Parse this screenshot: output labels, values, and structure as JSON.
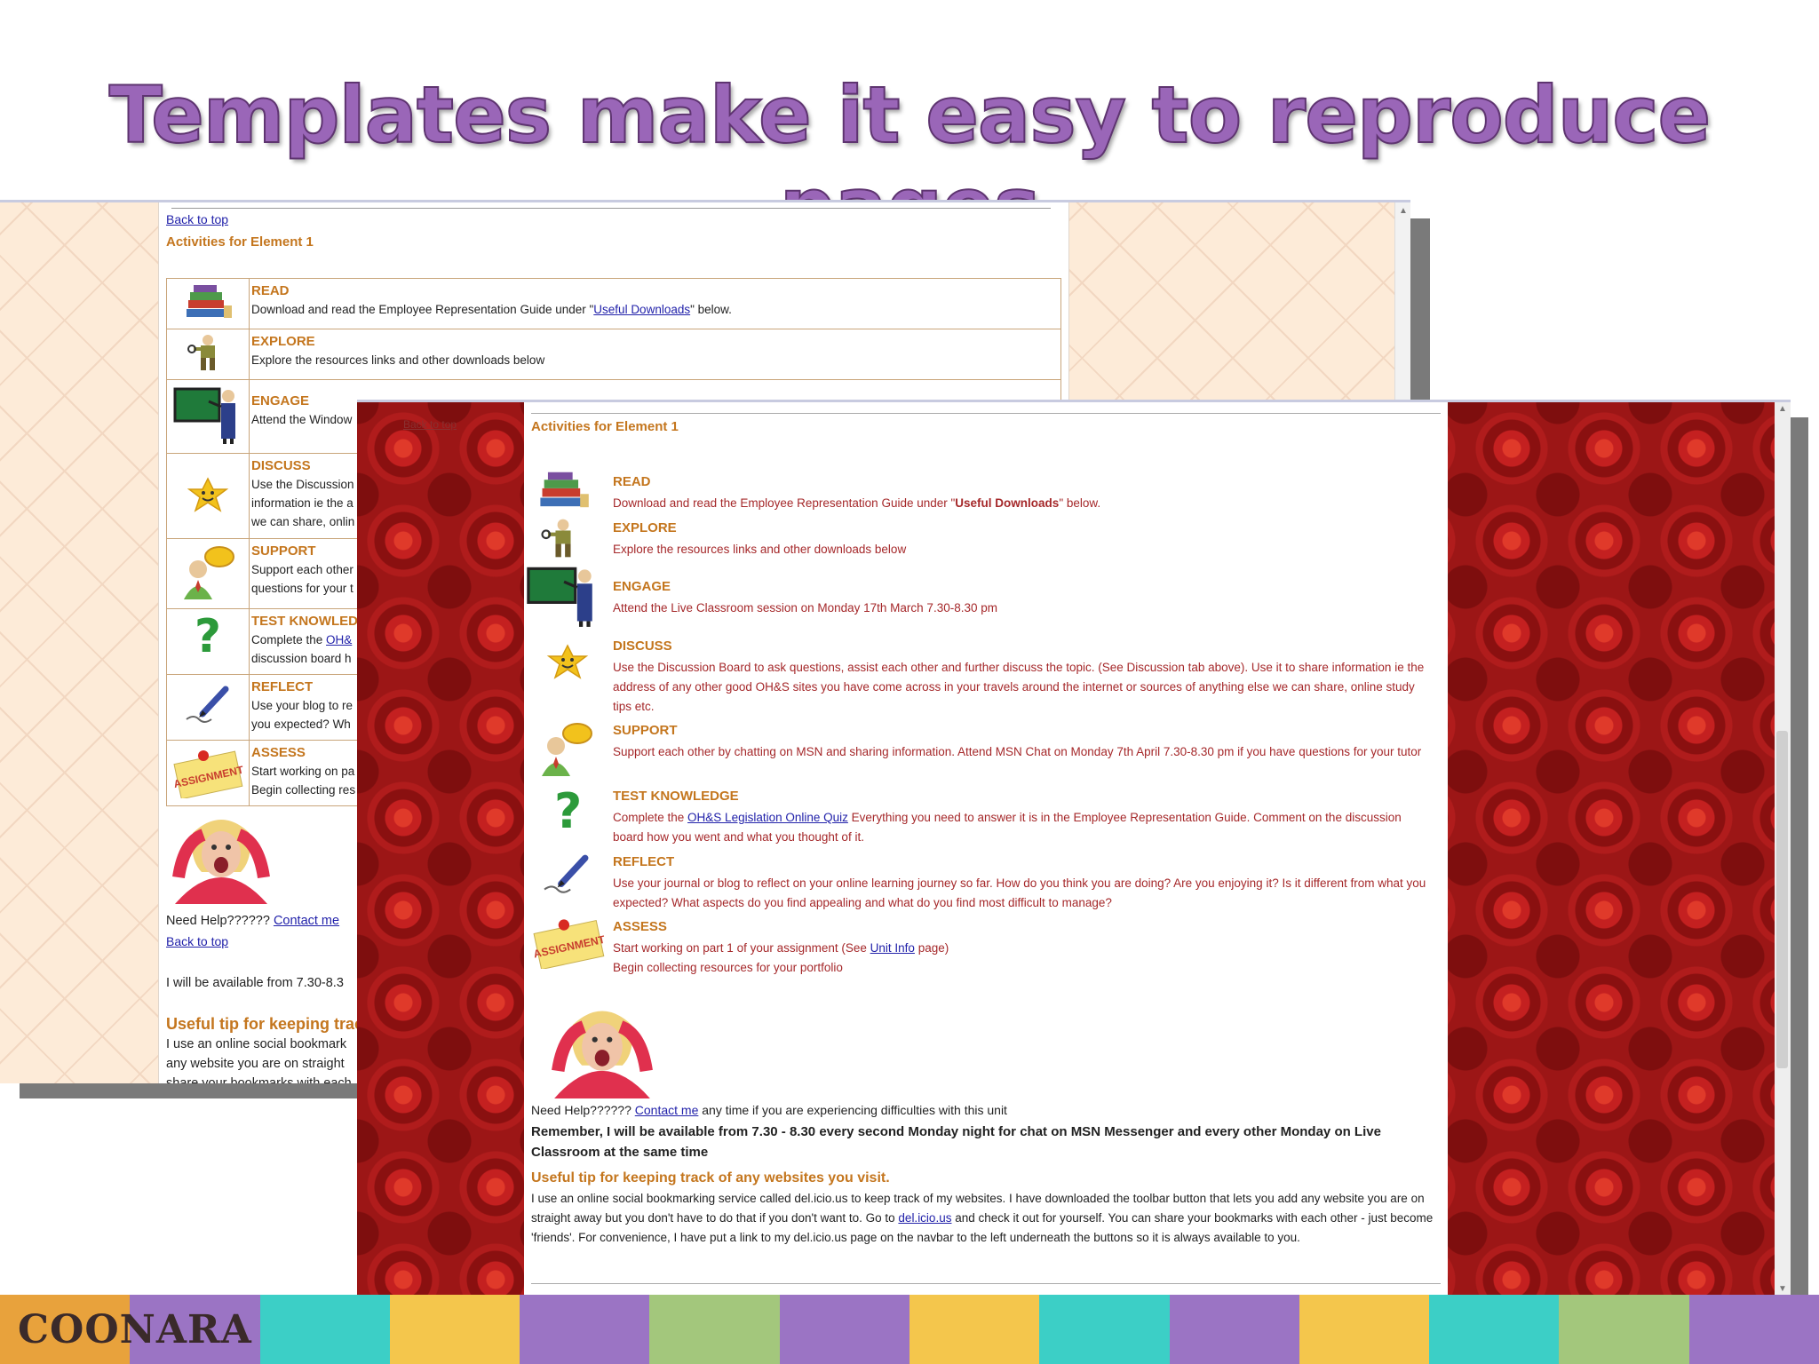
{
  "slide": {
    "title": "Templates make it easy to reproduce pages",
    "brand": "COONARA"
  },
  "back": {
    "back_to_top": "Back to top",
    "heading": "Activities for Element 1",
    "activities": [
      {
        "icon": "books-icon",
        "title": "READ",
        "lines": [
          "Download and read the Employee Representation Guide under \"",
          "Useful Downloads",
          "\" below."
        ]
      },
      {
        "icon": "explorer-icon",
        "title": "EXPLORE",
        "lines": [
          "Explore the resources links and other downloads below"
        ]
      },
      {
        "icon": "blackboard-teacher-icon",
        "title": "ENGAGE",
        "lines": [
          "Attend the Window"
        ]
      },
      {
        "icon": "smiley-star-icon",
        "title": "DISCUSS",
        "lines": [
          "Use the Discussion",
          "information ie the a",
          "we can share, onlin"
        ]
      },
      {
        "icon": "chat-person-icon",
        "title": "SUPPORT",
        "lines": [
          "Support each other",
          "questions for your t"
        ]
      },
      {
        "icon": "question-mark-icon",
        "title": "TEST KNOWLEDGE",
        "lines": [
          "Complete the ",
          "OH&",
          "discussion board h"
        ]
      },
      {
        "icon": "pen-writing-icon",
        "title": "REFLECT",
        "lines": [
          "Use your blog to re",
          "you expected? Wh"
        ]
      },
      {
        "icon": "assignment-note-icon",
        "title": "ASSESS",
        "lines": [
          "Start working on pa",
          "Begin collecting res"
        ]
      }
    ],
    "need_help": "Need Help?????? ",
    "contact_link": "Contact me",
    "back_to_top_2": "Back to top",
    "available": "I will be available from 7.30-8.3",
    "tip_heading": "Useful tip for keeping track",
    "tip_lines": [
      "I use an online social bookmark",
      "any website you are on straight",
      "share your bookmarks with each"
    ]
  },
  "front": {
    "nav_faint": "Back to top",
    "heading": "Activities for Element 1",
    "activities": [
      {
        "icon": "books-icon",
        "title": "READ",
        "body_pre": "Download and read the Employee Representation Guide under \"",
        "body_bold": "Useful Downloads",
        "body_post": "\" below."
      },
      {
        "icon": "explorer-icon",
        "title": "EXPLORE",
        "body": "Explore the resources links and other downloads below"
      },
      {
        "icon": "blackboard-teacher-icon",
        "title": "ENGAGE",
        "body": "Attend the Live Classroom session on Monday 17th March 7.30-8.30 pm"
      },
      {
        "icon": "smiley-star-icon",
        "title": "DISCUSS",
        "body": "Use the Discussion Board to ask questions, assist each other and further discuss the topic. (See Discussion tab above). Use it to share information ie the address of any other good OH&S sites you have come across in your travels around the internet or sources of anything else we can share, online study tips etc."
      },
      {
        "icon": "chat-person-icon",
        "title": "SUPPORT",
        "body": "Support each other by chatting on MSN and sharing information. Attend MSN Chat on Monday 7th April 7.30-8.30 pm if you have questions for your tutor"
      },
      {
        "icon": "question-mark-icon",
        "title": "TEST KNOWLEDGE",
        "body_pre": "Complete the ",
        "body_link": "OH&S Legislation Online Quiz",
        "body_post": " Everything you need to answer it is in the Employee Representation Guide. Comment on the discussion board how you went and what you thought of it."
      },
      {
        "icon": "pen-writing-icon",
        "title": "REFLECT",
        "body": "Use your journal or blog to reflect on your online learning journey so far. How do you think you are doing? Are you enjoying it? Is it different from what you expected? What aspects do you find appealing and what do you find most difficult to manage?"
      },
      {
        "icon": "assignment-note-icon",
        "title": "ASSESS",
        "body_pre": "Start working on part 1 of your assignment (See ",
        "body_link": "Unit Info",
        "body_post": " page)",
        "body_line2": "Begin collecting resources for your portfolio"
      }
    ],
    "need_help_pre": "Need Help?????? ",
    "contact_link": "Contact me",
    "need_help_post": " any time if you are experiencing difficulties with this unit",
    "remember": "Remember, I will be available from 7.30 - 8.30 every second Monday night for chat on MSN Messenger and every other Monday on Live Classroom at the same time",
    "tip_heading": "Useful tip for keeping track of any websites you visit.",
    "tip_pre": "I use an online social bookmarking service called del.icio.us to keep track of my websites. I have downloaded the toolbar button that lets you add any website you are on straight away but you don't have to do that if you don't want to. Go to ",
    "tip_link": "del.icio.us",
    "tip_post": " and check it out for yourself. You can share your bookmarks with each other - just become 'friends'. For convenience, I have put a link to my del.icio.us page on the navbar to the left underneath the buttons so it is always available to you."
  },
  "colors": {
    "title_purple": "#9a66b8",
    "orange_heading": "#c4761e",
    "front_body_red": "#a5282a",
    "banner": [
      "#e8a23c",
      "#9b74c4",
      "#3ccfc6",
      "#f4c64c",
      "#9b74c4",
      "#a3c77c",
      "#9b74c4",
      "#f4c64c",
      "#3ccfc6",
      "#9b74c4",
      "#f4c64c",
      "#3ccfc6",
      "#a3c77c",
      "#9b74c4"
    ]
  }
}
